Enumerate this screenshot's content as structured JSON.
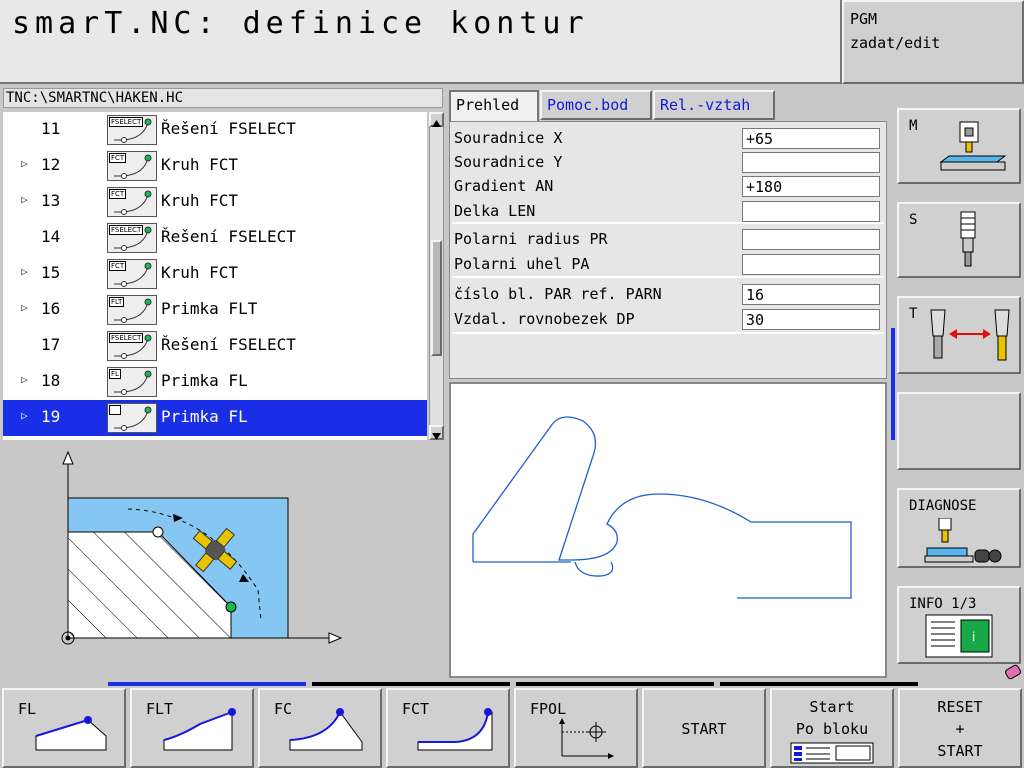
{
  "header": {
    "title": "smarT.NC: definice kontur"
  },
  "pgm": {
    "line1": "PGM",
    "line2": "zadat/edit"
  },
  "path": "TNC:\\SMARTNC\\HAKEN.HC",
  "tree": [
    {
      "num": "11",
      "tag": "FSELECT",
      "label": "Řešení FSELECT",
      "expandable": false,
      "selected": false
    },
    {
      "num": "12",
      "tag": "FCT",
      "label": "Kruh FCT",
      "expandable": true,
      "selected": false
    },
    {
      "num": "13",
      "tag": "FCT",
      "label": "Kruh FCT",
      "expandable": true,
      "selected": false
    },
    {
      "num": "14",
      "tag": "FSELECT",
      "label": "Řešení FSELECT",
      "expandable": false,
      "selected": false
    },
    {
      "num": "15",
      "tag": "FCT",
      "label": "Kruh FCT",
      "expandable": true,
      "selected": false
    },
    {
      "num": "16",
      "tag": "FLT",
      "label": "Primka FLT",
      "expandable": true,
      "selected": false
    },
    {
      "num": "17",
      "tag": "FSELECT",
      "label": "Řešení FSELECT",
      "expandable": false,
      "selected": false
    },
    {
      "num": "18",
      "tag": "FL",
      "label": "Primka FL",
      "expandable": true,
      "selected": false
    },
    {
      "num": "19",
      "tag": "FL",
      "label": "Primka FL",
      "expandable": true,
      "selected": true
    }
  ],
  "tabs": [
    "Prehled",
    "Pomoc.bod",
    "Rel.-vztah"
  ],
  "form": {
    "x_label": "Souradnice X",
    "x_value": "+65",
    "y_label": "Souradnice Y",
    "y_value": "",
    "an_label": "Gradient AN",
    "an_value": "+180",
    "len_label": "Delka LEN",
    "len_value": "",
    "pr_label": "Polarni radius PR",
    "pr_value": "",
    "pa_label": "Polarni uhel PA",
    "pa_value": "",
    "parn_label": "číslo bl. PAR ref. PARN",
    "parn_value": "16",
    "dp_label": "Vzdal. rovnobezek DP",
    "dp_value": "30"
  },
  "side": {
    "m": "M",
    "s": "S",
    "t": "T",
    "diag": "DIAGNOSE",
    "info": "INFO 1/3"
  },
  "softkeys": {
    "fl": "FL",
    "flt": "FLT",
    "fc": "FC",
    "fct": "FCT",
    "fpol": "FPOL",
    "start": "START",
    "startblk1": "Start",
    "startblk2": "Po bloku",
    "reset1": "RESET",
    "reset2": "+",
    "reset3": "START"
  },
  "colors": {
    "selection": "#1a2ee8",
    "contour": "#1e60d0",
    "accent_green": "#19b84a"
  }
}
